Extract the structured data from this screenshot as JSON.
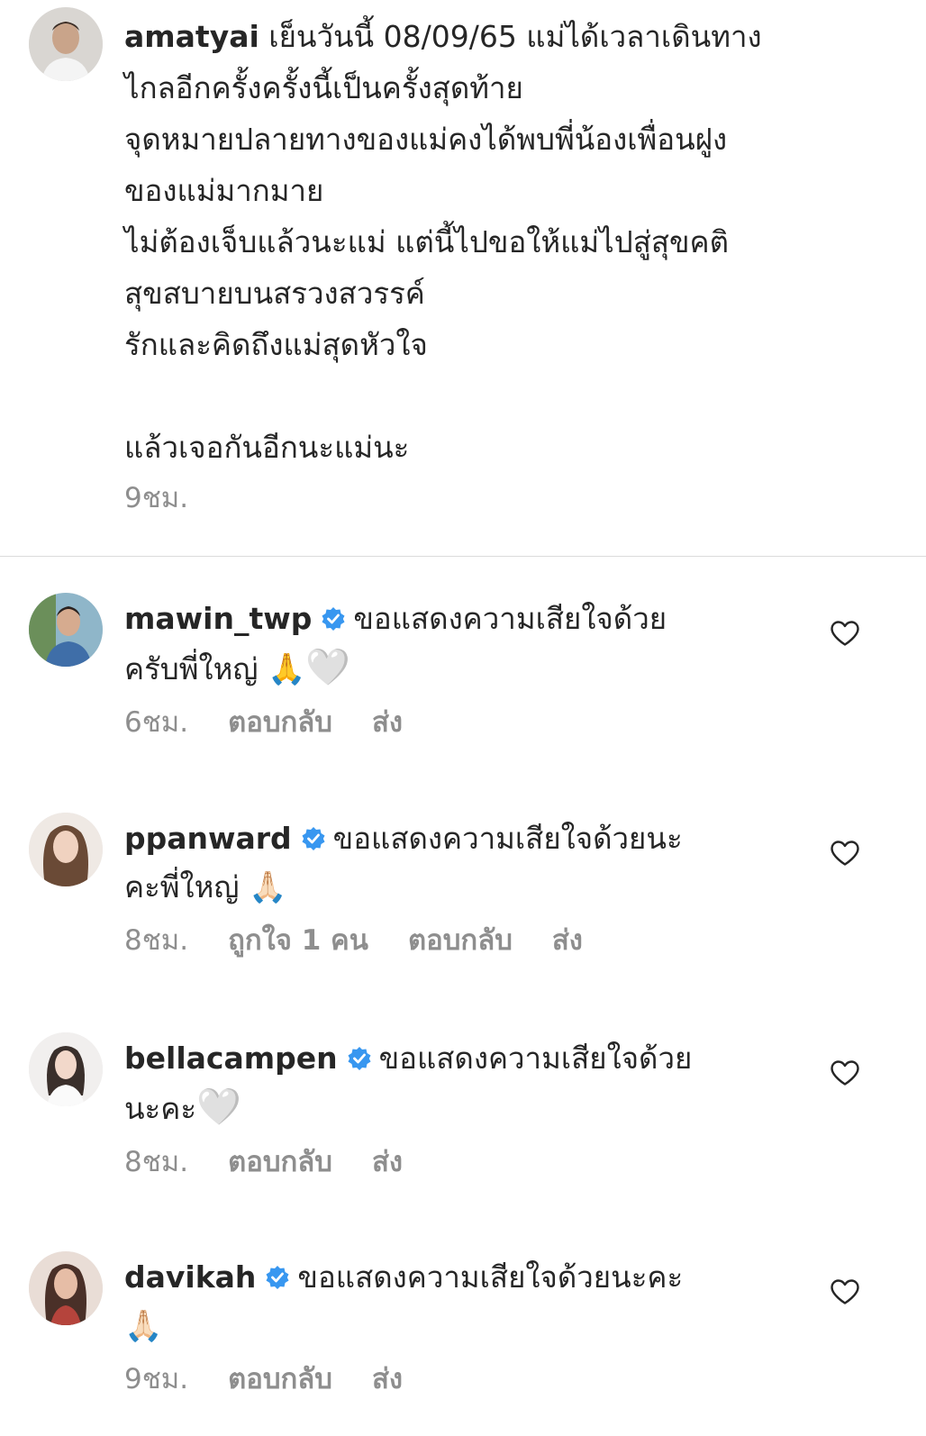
{
  "post": {
    "username": "amatyai",
    "lines": [
      "เย็นวันนี้ 08/09/65 แม่ได้เวลาเดินทาง",
      "ไกลอีกครั้งครั้งนี้เป็นครั้งสุดท้าย",
      "จุดหมายปลายทางของแม่คงได้พบพี่น้องเพื่อนฝูง",
      "ของแม่มากมาย",
      "ไม่ต้องเจ็บแล้วนะแม่ แต่นี้ไปขอให้แม่ไปสู่สุขคติ",
      "สุขสบายบนสรวงสวรรค์",
      "รักและคิดถึงแม่สุดหัวใจ"
    ],
    "closing": "แล้วเจอกันอีกนะแม่นะ",
    "time": "9ชม."
  },
  "labels": {
    "reply": "ตอบกลับ",
    "send": "ส่ง"
  },
  "comments": [
    {
      "username": "mawin_twp",
      "text_1": "ขอแสดงความเสียใจด้วย",
      "text_2": "ครับพี่ใหญ่",
      "emoji": "🙏",
      "heart_emoji": "🤍",
      "time": "6ชม.",
      "likes": ""
    },
    {
      "username": "ppanward",
      "text_1": "ขอแสดงความเสียใจด้วยนะ",
      "text_2": "คะพี่ใหญ่",
      "emoji": "🙏🏻",
      "heart_emoji": "",
      "time": "8ชม.",
      "likes": "ถูกใจ 1 คน"
    },
    {
      "username": "bellacampen",
      "text_1": "ขอแสดงความเสียใจด้วย",
      "text_2": "นะคะ",
      "emoji": "",
      "heart_emoji": "🤍",
      "time": "8ชม.",
      "likes": ""
    },
    {
      "username": "davikah",
      "text_1": "ขอแสดงความเสียใจด้วยนะคะ",
      "text_2": "",
      "emoji": "🙏🏻",
      "heart_emoji": "",
      "time": "9ชม.",
      "likes": ""
    }
  ],
  "colors": {
    "text": "#262626",
    "muted": "#8e8e8e",
    "verified": "#3897f0",
    "divider": "#dbdbdb"
  }
}
